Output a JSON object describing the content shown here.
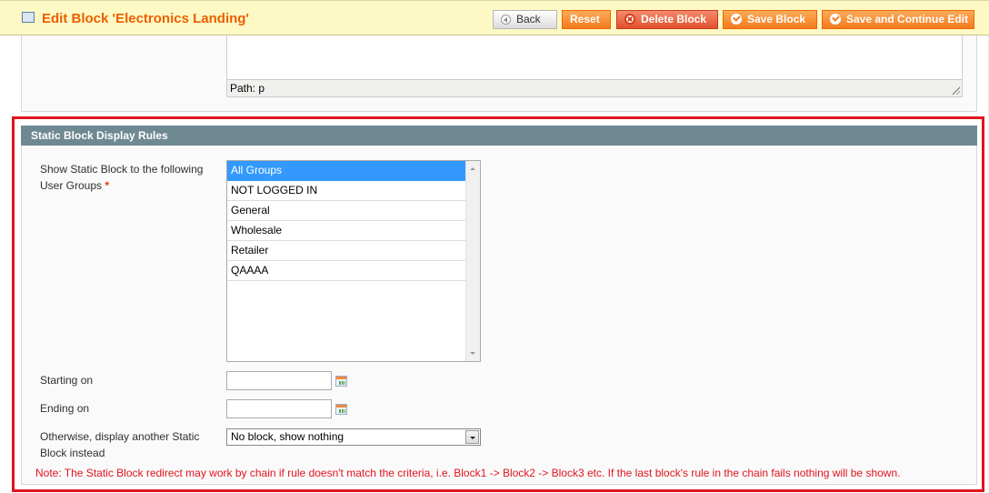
{
  "header": {
    "title": "Edit Block 'Electronics Landing'",
    "title_icon": "grid-table-icon",
    "buttons": {
      "back": "Back",
      "reset": "Reset",
      "delete": "Delete Block",
      "save": "Save Block",
      "save_continue": "Save and Continue Edit"
    }
  },
  "editor": {
    "path_label": "Path: p"
  },
  "display_rules": {
    "section_title": "Static Block Display Rules",
    "user_groups": {
      "label": "Show Static Block to the following User Groups",
      "required_mark": "*",
      "options": [
        "All Groups",
        "NOT LOGGED IN",
        "General",
        "Wholesale",
        "Retailer",
        "QAAAA"
      ],
      "selected": "All Groups"
    },
    "starting_on": {
      "label": "Starting on",
      "value": ""
    },
    "ending_on": {
      "label": "Ending on",
      "value": ""
    },
    "fallback": {
      "label": "Otherwise, display another Static Block instead",
      "selected": "No block, show nothing"
    },
    "note": "Note: The Static Block redirect may work by chain if rule doesn't match the criteria, i.e. Block1 -> Block2 -> Block3 etc. If the last block's rule in the chain fails nothing will be shown."
  },
  "colors": {
    "title": "#eb5e00",
    "button_orange": "#f57a1d",
    "button_delete": "#e14f2c",
    "section_head": "#6f8992",
    "highlight_frame": "#e1141e",
    "note_text": "#e1141e",
    "selected_option": "#3399ff"
  }
}
